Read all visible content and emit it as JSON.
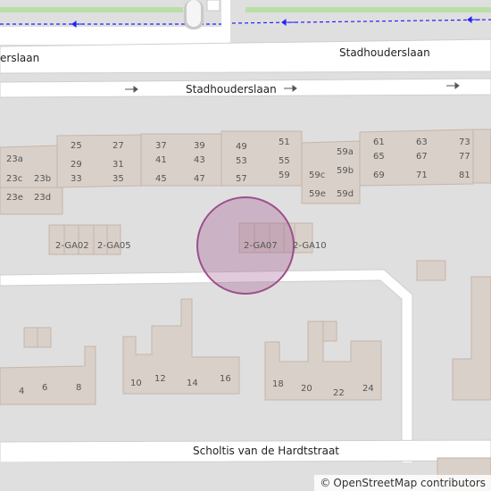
{
  "streets": {
    "top_left": "erslaan",
    "top_right": "Stadhouderslaan",
    "middle": "Stadhouderslaan",
    "bottom": "Scholtis van de Hardtstraat"
  },
  "houses": {
    "n23a": "23a",
    "n23c": "23c",
    "n23b": "23b",
    "n23e": "23e",
    "n23d": "23d",
    "n25": "25",
    "n27": "27",
    "n29": "29",
    "n31": "31",
    "n33": "33",
    "n35": "35",
    "n37": "37",
    "n39": "39",
    "n41": "41",
    "n43": "43",
    "n45": "45",
    "n47": "47",
    "n49": "49",
    "n51": "51",
    "n53": "53",
    "n55": "55",
    "n57": "57",
    "n59": "59",
    "n59a": "59a",
    "n59b": "59b",
    "n59c": "59c",
    "n59d": "59d",
    "n59e": "59e",
    "n61": "61",
    "n63": "63",
    "n65": "65",
    "n67": "67",
    "n69": "69",
    "n71": "71",
    "n73": "73",
    "n77": "77",
    "n81": "81",
    "ga02": "2-GA02",
    "ga05": "2-GA05",
    "ga07": "2-GA07",
    "ga10": "2-GA10",
    "n4": "4",
    "n6": "6",
    "n8": "8",
    "n10": "10",
    "n12": "12",
    "n14": "14",
    "n16": "16",
    "n18": "18",
    "n20": "20",
    "n22": "22",
    "n24": "24"
  },
  "attribution": {
    "symbol": "©",
    "text": "OpenStreetMap contributors"
  },
  "colors": {
    "road": "#ffffff",
    "landuse": "#e0dfdf",
    "building": "#d9d0c9",
    "building_stroke": "#c4b6ab",
    "highlight": "#9c4f8c",
    "cycleway": "#2020ff",
    "park": "#b9dfa6"
  }
}
